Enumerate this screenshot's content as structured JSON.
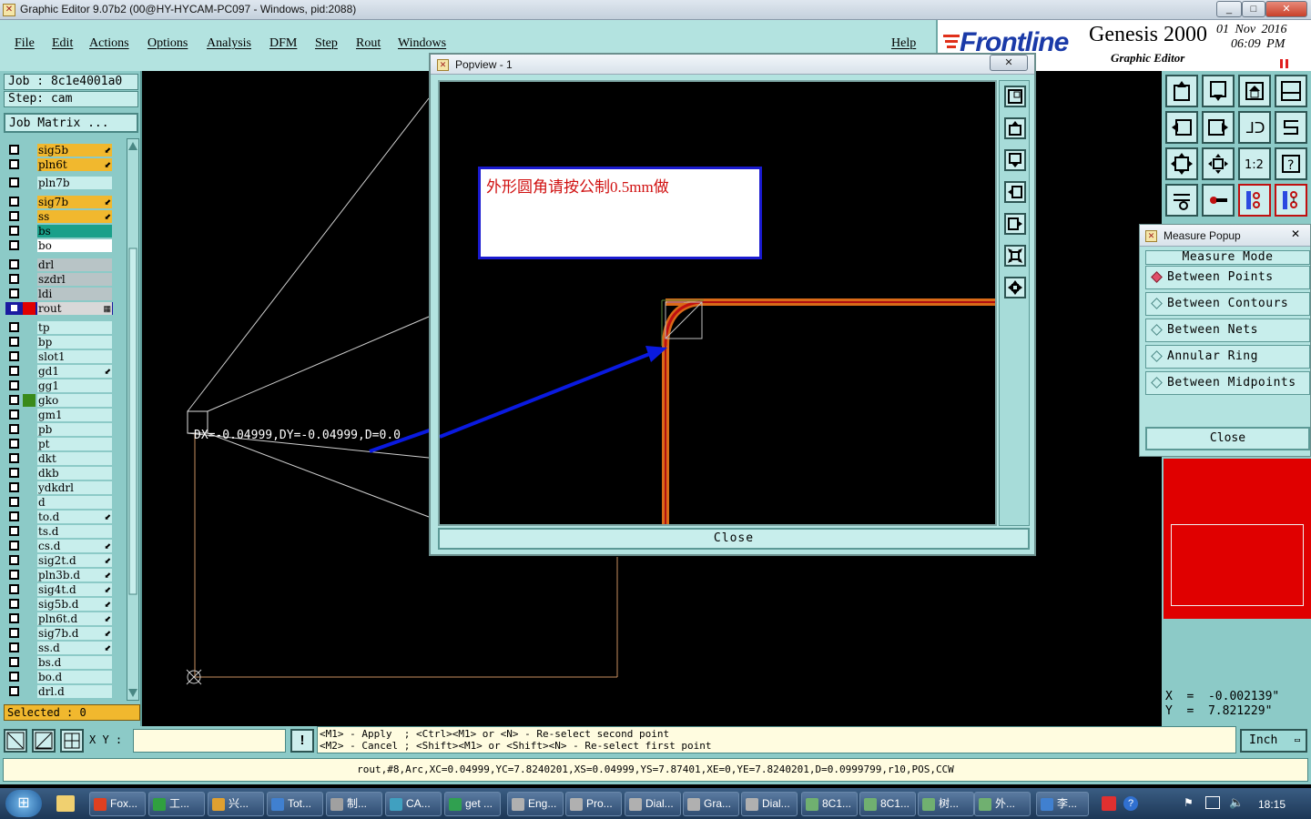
{
  "window": {
    "title": "Graphic Editor 9.07b2 (00@HY-HYCAM-PC097 - Windows, pid:2088)",
    "controls": [
      "_",
      "□",
      "✕"
    ]
  },
  "menu": [
    "File",
    "Edit",
    "Actions",
    "Options",
    "Analysis",
    "DFM",
    "Step",
    "Rout",
    "Windows"
  ],
  "help_label": "Help",
  "brand": {
    "logo": "Frontline",
    "product": "Genesis 2000",
    "subtitle": "Graphic Editor",
    "date": "01 Nov 2016",
    "time": "06:09 PM"
  },
  "job": {
    "job_label": "Job  : 8c1e4001a0",
    "step_label": "Step: cam",
    "matrix_label": "Job Matrix ..."
  },
  "layers": [
    {
      "name": "sig5b",
      "color": "#f1b82e",
      "mark": "⬋"
    },
    {
      "name": "pln6t",
      "color": "#f1b82e",
      "mark": "⬋"
    },
    {
      "name": "pln7b",
      "color": "#c8eeec",
      "mark": ""
    },
    {
      "name": "sig7b",
      "color": "#f1b82e",
      "mark": "⬋"
    },
    {
      "name": "ss",
      "color": "#f1b82e",
      "mark": "⬋"
    },
    {
      "name": "bs",
      "color": "#1aa08a",
      "mark": ""
    },
    {
      "name": "bo",
      "color": "#ffffff",
      "mark": ""
    },
    {
      "name": "drl",
      "color": "#b8c4c6",
      "mark": ""
    },
    {
      "name": "szdrl",
      "color": "#b8c4c6",
      "mark": ""
    },
    {
      "name": "ldi",
      "color": "#b8c4c6",
      "mark": ""
    },
    {
      "name": "rout",
      "color": "#d8d8d8",
      "mark": "▦"
    },
    {
      "name": "tp",
      "color": "#c8eeec",
      "mark": ""
    },
    {
      "name": "bp",
      "color": "#c8eeec",
      "mark": ""
    },
    {
      "name": "slot1",
      "color": "#c8eeec",
      "mark": ""
    },
    {
      "name": "gd1",
      "color": "#c8eeec",
      "mark": "⬋"
    },
    {
      "name": "gg1",
      "color": "#c8eeec",
      "mark": ""
    },
    {
      "name": "gko",
      "color": "#c8eeec",
      "mark": ""
    },
    {
      "name": "gm1",
      "color": "#c8eeec",
      "mark": ""
    },
    {
      "name": "pb",
      "color": "#c8eeec",
      "mark": ""
    },
    {
      "name": "pt",
      "color": "#c8eeec",
      "mark": ""
    },
    {
      "name": "dkt",
      "color": "#c8eeec",
      "mark": ""
    },
    {
      "name": "dkb",
      "color": "#c8eeec",
      "mark": ""
    },
    {
      "name": "ydkdrl",
      "color": "#c8eeec",
      "mark": ""
    },
    {
      "name": "d",
      "color": "#c8eeec",
      "mark": ""
    },
    {
      "name": "to.d",
      "color": "#c8eeec",
      "mark": "⬋"
    },
    {
      "name": "ts.d",
      "color": "#c8eeec",
      "mark": ""
    },
    {
      "name": "cs.d",
      "color": "#c8eeec",
      "mark": "⬋"
    },
    {
      "name": "sig2t.d",
      "color": "#c8eeec",
      "mark": "⬋"
    },
    {
      "name": "pln3b.d",
      "color": "#c8eeec",
      "mark": "⬋"
    },
    {
      "name": "sig4t.d",
      "color": "#c8eeec",
      "mark": "⬋"
    },
    {
      "name": "sig5b.d",
      "color": "#c8eeec",
      "mark": "⬋"
    },
    {
      "name": "pln6t.d",
      "color": "#c8eeec",
      "mark": "⬋"
    },
    {
      "name": "sig7b.d",
      "color": "#c8eeec",
      "mark": "⬋"
    },
    {
      "name": "ss.d",
      "color": "#c8eeec",
      "mark": "⬋"
    },
    {
      "name": "bs.d",
      "color": "#c8eeec",
      "mark": ""
    },
    {
      "name": "bo.d",
      "color": "#c8eeec",
      "mark": ""
    },
    {
      "name": "drl.d",
      "color": "#c8eeec",
      "mark": ""
    }
  ],
  "selected_label": "Selected : 0",
  "canvas": {
    "measure_text": "DX=-0.04999,DY=-0.04999,D=0.0"
  },
  "popview": {
    "title": "Popview - 1",
    "close_x": "✕",
    "annotation": "外形圆角请按公制0.5mm做",
    "close_label": "Close"
  },
  "measure_popup": {
    "title": "Measure Popup",
    "close_x": "✕",
    "mode_header": "Measure Mode",
    "options": [
      "Between Points",
      "Between Contours",
      "Between Nets",
      "Annular Ring",
      "Between Midpoints"
    ],
    "selected_option": 0,
    "close_label": "Close"
  },
  "coords": {
    "x_label": "X  =  -0.002139\"",
    "y_label": "Y  =  7.821229\""
  },
  "bottom": {
    "xy_label": "X Y :",
    "xy_value": "",
    "hint_line1": "<M1> - Apply  ; <Ctrl><M1> or <N> - Re-select second point",
    "hint_line2": "<M2> - Cancel ; <Shift><M1> or <Shift><N> - Re-select first point",
    "unit_label": "Inch",
    "status": "rout,#8,Arc,XC=0.04999,YC=7.8240201,XS=0.04999,YS=7.87401,XE=0,YE=7.8240201,D=0.0999799,r10,POS,CCW"
  },
  "taskbar": {
    "start": "⊞",
    "items": [
      "Fox...",
      "工...",
      "兴...",
      "Tot...",
      "制...",
      "CA...",
      "get ...",
      "Eng...",
      "Pro...",
      "Dial...",
      "Gra...",
      "Dial...",
      "8C1...",
      "8C1...",
      "树...",
      "外...",
      "李..."
    ],
    "clock": "18:15"
  }
}
